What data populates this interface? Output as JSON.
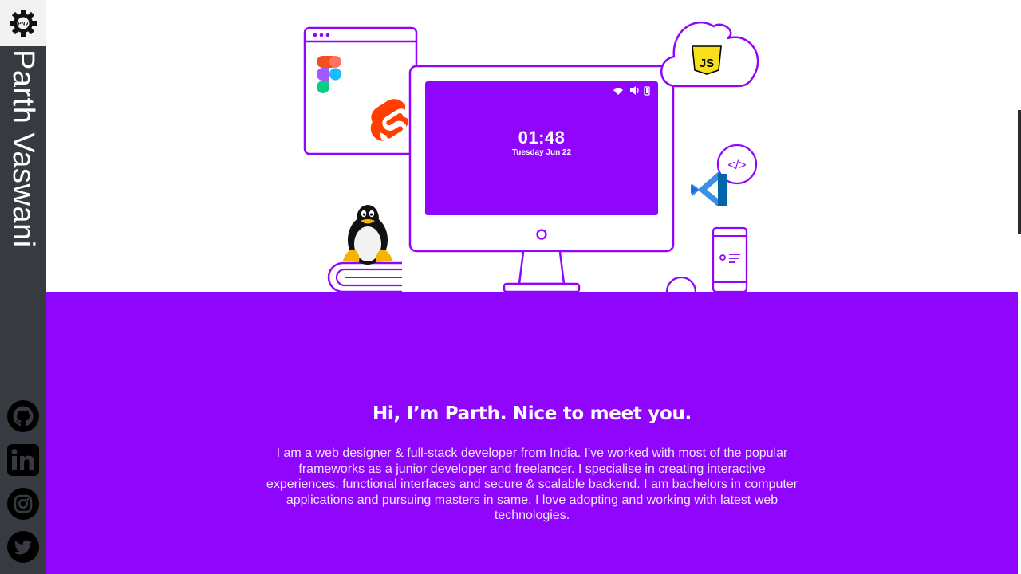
{
  "sidebar": {
    "logo_text": "PNV",
    "name": "Parth Vaswani",
    "social": [
      {
        "icon": "github-icon"
      },
      {
        "icon": "linkedin-icon"
      },
      {
        "icon": "instagram-icon"
      },
      {
        "icon": "twitter-icon"
      }
    ]
  },
  "hero": {
    "screen": {
      "time": "01:48",
      "date": "Tuesday Jun 22"
    },
    "js_badge": "JS",
    "code_badge": "</>",
    "colors": {
      "accent": "#9006fc",
      "outline": "#9006fc"
    }
  },
  "intro": {
    "heading": "Hi, I’m Parth. Nice to meet you.",
    "body": "I am a web designer & full-stack developer from India. I've worked with most of the popular frameworks as a junior developer and freelancer. I specialise in creating interactive experiences, functional interfaces and secure & scalable backend. I am bachelors in computer applications and pursuing masters in same. I love adopting and working with latest web technologies."
  }
}
